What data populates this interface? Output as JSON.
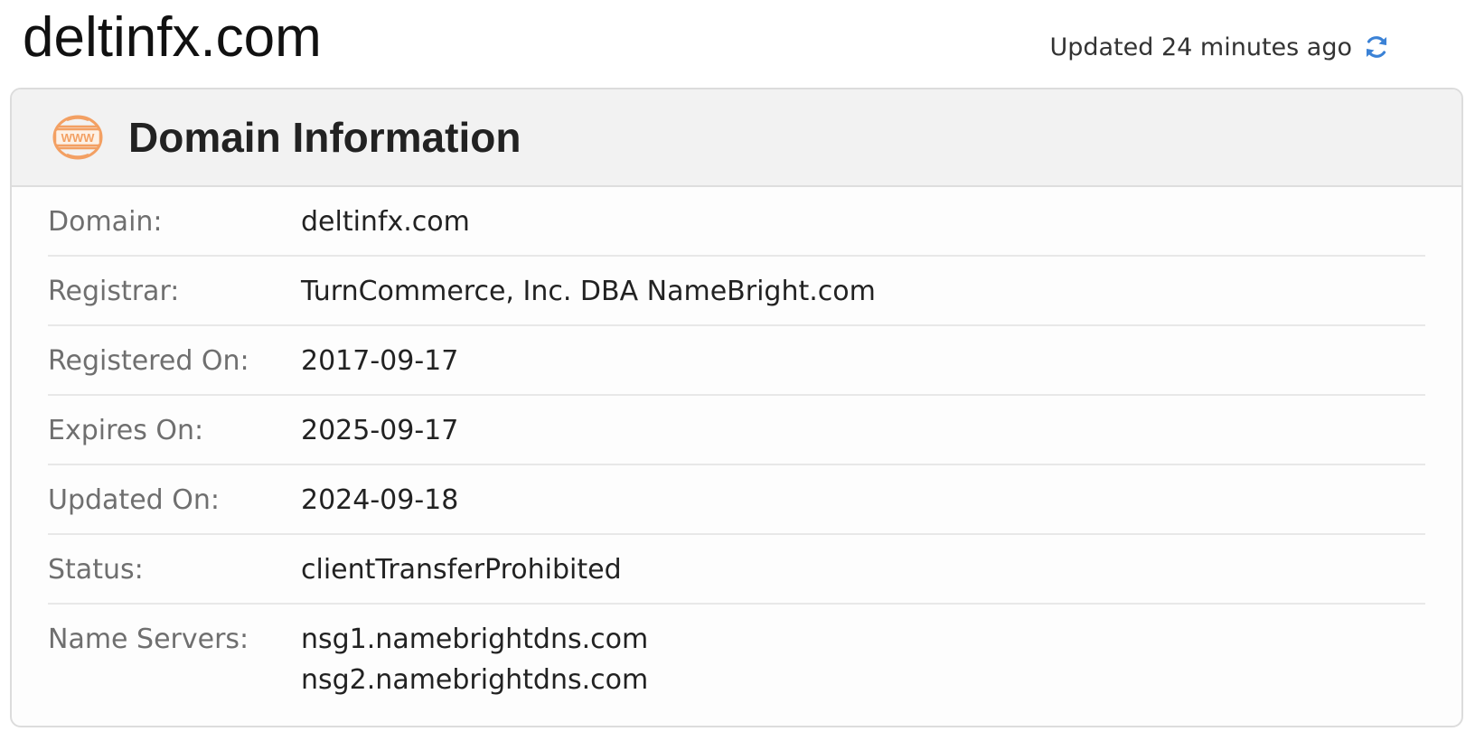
{
  "page": {
    "title": "deltinfx.com",
    "updated_text": "Updated 24 minutes ago"
  },
  "card": {
    "title": "Domain Information",
    "icon": "www-globe-icon",
    "icon_text": "WWW",
    "icon_color": "#f3a063",
    "refresh_icon_color": "#3b82d6"
  },
  "rows": [
    {
      "label": "Domain:",
      "value": "deltinfx.com"
    },
    {
      "label": "Registrar:",
      "value": "TurnCommerce, Inc. DBA NameBright.com"
    },
    {
      "label": "Registered On:",
      "value": "2017-09-17"
    },
    {
      "label": "Expires On:",
      "value": "2025-09-17"
    },
    {
      "label": "Updated On:",
      "value": "2024-09-18"
    },
    {
      "label": "Status:",
      "value": "clientTransferProhibited"
    }
  ],
  "name_servers": {
    "label": "Name Servers:",
    "values": [
      "nsg1.namebrightdns.com",
      "nsg2.namebrightdns.com"
    ]
  }
}
